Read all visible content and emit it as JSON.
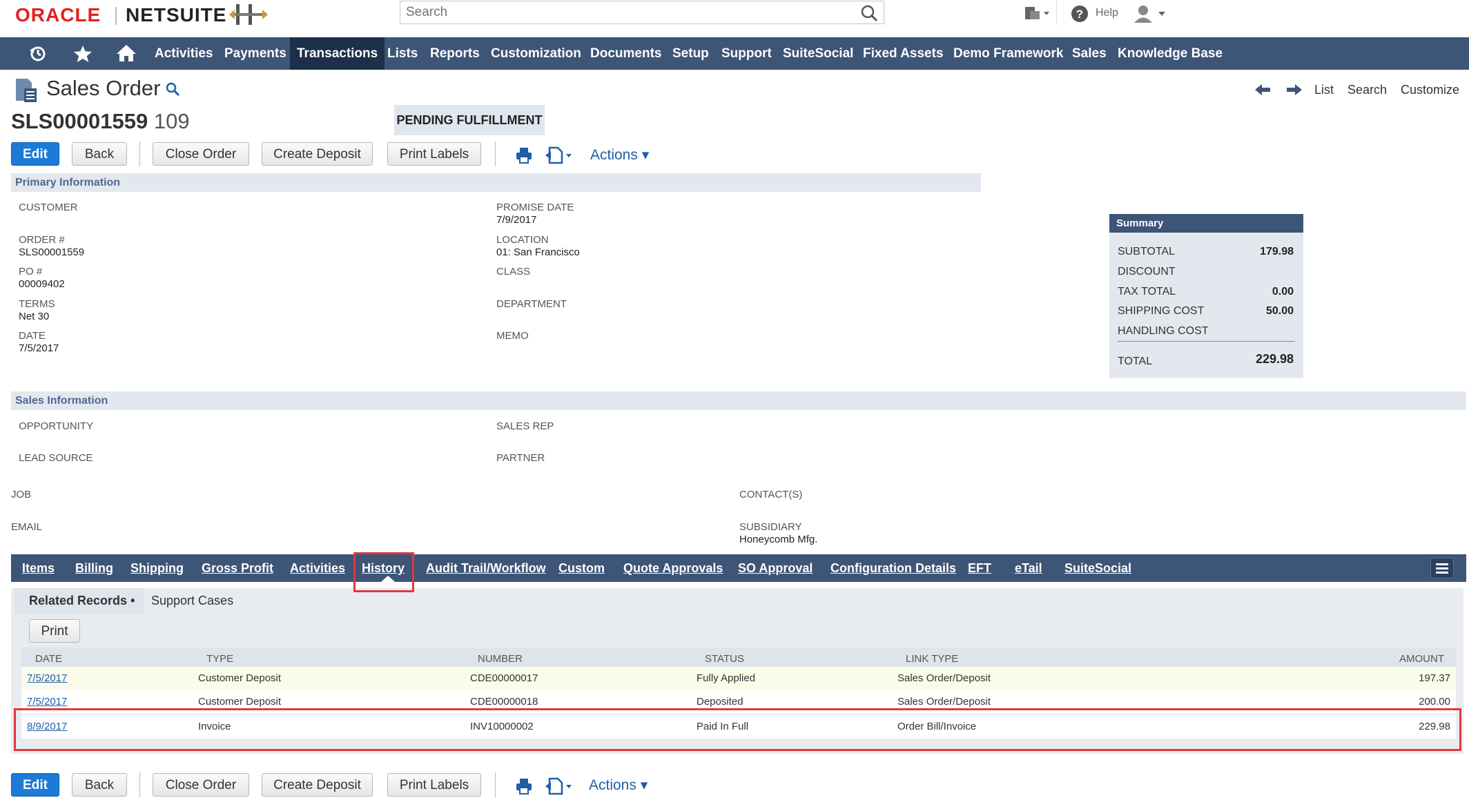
{
  "header": {
    "logo_oracle": "ORACLE",
    "logo_netsuite": "NETSUITE",
    "search_placeholder": "Search",
    "help_label": "Help"
  },
  "nav": {
    "items": [
      "Activities",
      "Payments",
      "Transactions",
      "Lists",
      "Reports",
      "Customization",
      "Documents",
      "Setup",
      "Support",
      "SuiteSocial",
      "Fixed Assets",
      "Demo Framework",
      "Sales",
      "Knowledge Base"
    ],
    "active": "Transactions"
  },
  "page": {
    "title": "Sales Order",
    "order_number": "SLS00001559",
    "order_number_suffix": "109",
    "status": "PENDING FULFILLMENT",
    "top_links": [
      "List",
      "Search",
      "Customize"
    ]
  },
  "toolbar": {
    "edit": "Edit",
    "back": "Back",
    "close_order": "Close Order",
    "create_deposit": "Create Deposit",
    "print_labels": "Print Labels",
    "actions": "Actions"
  },
  "primary_info": {
    "heading": "Primary Information",
    "customer_label": "CUSTOMER",
    "order_label": "ORDER #",
    "order_value": "SLS00001559",
    "po_label": "PO #",
    "po_value": "00009402",
    "terms_label": "TERMS",
    "terms_value": "Net 30",
    "date_label": "DATE",
    "date_value": "7/5/2017",
    "promise_label": "PROMISE DATE",
    "promise_value": "7/9/2017",
    "location_label": "LOCATION",
    "location_value": "01: San Francisco",
    "class_label": "CLASS",
    "department_label": "DEPARTMENT",
    "memo_label": "MEMO"
  },
  "summary": {
    "heading": "Summary",
    "subtotal_label": "SUBTOTAL",
    "subtotal_value": "179.98",
    "discount_label": "DISCOUNT",
    "tax_label": "TAX TOTAL",
    "tax_value": "0.00",
    "shipping_label": "SHIPPING COST",
    "shipping_value": "50.00",
    "handling_label": "HANDLING COST",
    "total_label": "TOTAL",
    "total_value": "229.98"
  },
  "sales_info": {
    "heading": "Sales Information",
    "opportunity_label": "OPPORTUNITY",
    "lead_source_label": "LEAD SOURCE",
    "sales_rep_label": "SALES REP",
    "partner_label": "PARTNER",
    "job_label": "JOB",
    "email_label": "EMAIL",
    "contacts_label": "CONTACT(S)",
    "subsidiary_label": "SUBSIDIARY",
    "subsidiary_value": "Honeycomb Mfg."
  },
  "subtabs": {
    "items": [
      "Items",
      "Billing",
      "Shipping",
      "Gross Profit",
      "Activities",
      "History",
      "Audit Trail/Workflow",
      "Custom",
      "Quote Approvals",
      "SO Approval",
      "Configuration Details",
      "EFT",
      "eTail",
      "SuiteSocial"
    ],
    "active": "History",
    "sub_items": [
      "Related Records",
      "Support Cases"
    ],
    "print": "Print"
  },
  "history_table": {
    "columns": [
      "DATE",
      "TYPE",
      "NUMBER",
      "STATUS",
      "LINK TYPE",
      "AMOUNT"
    ],
    "rows": [
      [
        "7/5/2017",
        "Customer Deposit",
        "CDE00000017",
        "Fully Applied",
        "Sales Order/Deposit",
        "197.37"
      ],
      [
        "7/5/2017",
        "Customer Deposit",
        "CDE00000018",
        "Deposited",
        "Sales Order/Deposit",
        "200.00"
      ],
      [
        "8/9/2017",
        "Invoice",
        "INV10000002",
        "Paid In Full",
        "Order Bill/Invoice",
        "229.98"
      ]
    ]
  },
  "colors": {
    "nav_bg": "#3d5577",
    "accent_blue": "#1b7bd6",
    "highlight_red": "#e0393e",
    "status_badge_bg": "#e0e6ee"
  }
}
